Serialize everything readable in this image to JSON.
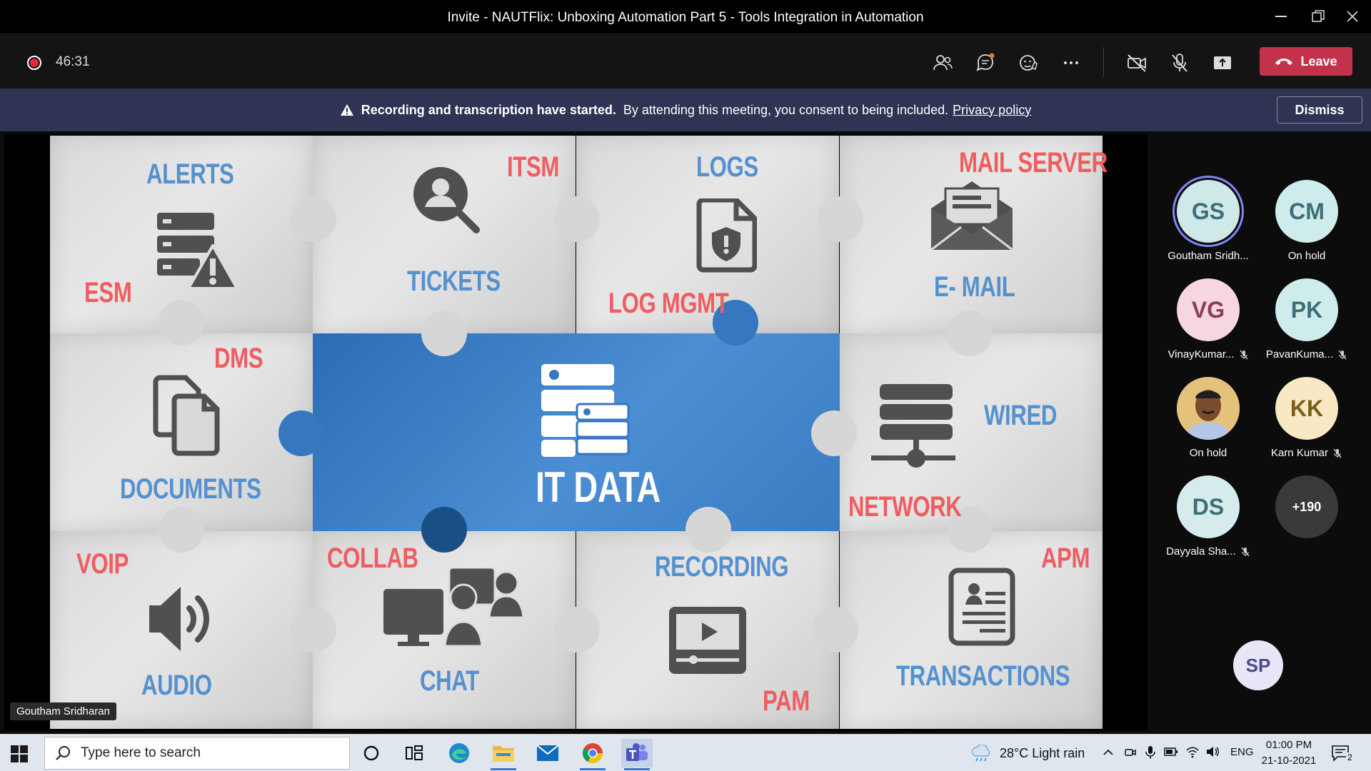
{
  "window": {
    "title": "Invite - NAUTFlix: Unboxing Automation Part 5 - Tools Integration in Automation",
    "controls": [
      "minimize",
      "restore",
      "close"
    ]
  },
  "meeting": {
    "elapsed": "46:31",
    "leave_label": "Leave"
  },
  "banner": {
    "bold": "Recording and transcription have started.",
    "text": "By attending this meeting, you consent to being included.",
    "link": "Privacy policy",
    "dismiss": "Dismiss"
  },
  "slide": {
    "center": "IT DATA",
    "labels": {
      "alerts": "ALERTS",
      "esm": "ESM",
      "itsm": "ITSM",
      "tickets": "TICKETS",
      "logs": "LOGS",
      "log_mgmt": "LOG MGMT",
      "mail_server": "MAIL SERVER",
      "email": "E- MAIL",
      "dms": "DMS",
      "documents": "DOCUMENTS",
      "wired": "WIRED",
      "network": "NETWORK",
      "voip": "VOIP",
      "audio": "AUDIO",
      "collab": "COLLAB",
      "chat": "CHAT",
      "recording": "RECORDING",
      "pam": "PAM",
      "apm": "APM",
      "transactions": "TRANSACTIONS"
    },
    "colors": {
      "accent_red": "#ef5d61",
      "accent_blue": "#5591cf",
      "center_blue": "#3777bf"
    }
  },
  "presenter": {
    "name": "Goutham Sridharan"
  },
  "participants": [
    {
      "initials": "GS",
      "name": "Goutham Sridh...",
      "bg": "#cfe8e8",
      "fg": "#3d6f78",
      "speaking": true,
      "muted": false
    },
    {
      "initials": "CM",
      "name": "On hold",
      "bg": "#cfecec",
      "fg": "#3d6f78",
      "speaking": false,
      "muted": false
    },
    {
      "initials": "VG",
      "name": "VinayKumar...",
      "bg": "#f6d6e0",
      "fg": "#8a3e58",
      "speaking": false,
      "muted": true
    },
    {
      "initials": "PK",
      "name": "PavanKuma...",
      "bg": "#cfecec",
      "fg": "#3d6f78",
      "speaking": false,
      "muted": true
    },
    {
      "initials": "",
      "name": "On hold",
      "bg": "#e7c07a",
      "fg": "#333",
      "speaking": false,
      "muted": false,
      "photo": true
    },
    {
      "initials": "KK",
      "name": "Karn Kumar",
      "bg": "#f8e9c4",
      "fg": "#7a5e1a",
      "speaking": false,
      "muted": true
    },
    {
      "initials": "DS",
      "name": "Dayyala Sha...",
      "bg": "#d6ecec",
      "fg": "#3d6f78",
      "speaking": false,
      "muted": true
    },
    {
      "initials": "+190",
      "name": "",
      "bg": "#3a3a3a",
      "fg": "#ffffff",
      "speaking": false,
      "muted": false
    }
  ],
  "self": {
    "initials": "SP"
  },
  "taskbar": {
    "search_placeholder": "Type here to search",
    "weather": "28°C  Light rain",
    "lang": "ENG",
    "time": "01:00 PM",
    "date": "21-10-2021",
    "notification_count": "2"
  }
}
